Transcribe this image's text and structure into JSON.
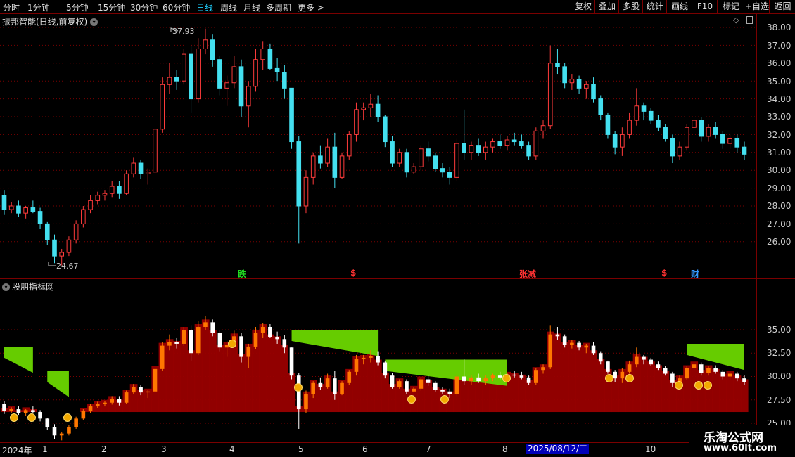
{
  "toolbar": {
    "periods": [
      "分时",
      "1分钟",
      "5分钟",
      "15分钟",
      "30分钟",
      "60分钟",
      "日线",
      "周线",
      "月线",
      "多周期",
      "更多 >"
    ],
    "active_period": "日线",
    "right_buttons": [
      "复权",
      "叠加",
      "多股",
      "统计",
      "画线",
      "F10",
      "+自选",
      "返回"
    ],
    "mark_label": "标记"
  },
  "main_chart": {
    "title": "振邦智能(日线,前复权)",
    "high_label": "37.93",
    "low_label": "24.67",
    "y_ticks": [
      "38.00",
      "37.00",
      "36.00",
      "35.00",
      "34.00",
      "33.00",
      "32.00",
      "31.00",
      "30.00",
      "29.00",
      "28.00",
      "27.00",
      "26.00"
    ],
    "signals": [
      {
        "text": "跌",
        "color": "#22dd22"
      },
      {
        "text": "$",
        "color": "#ff3333"
      },
      {
        "text": "张减",
        "color": "#ff3333"
      },
      {
        "text": "$",
        "color": "#ff3333"
      },
      {
        "text": "财",
        "color": "#3399ff"
      }
    ]
  },
  "indicator": {
    "title": "股朋指标网",
    "y_ticks": [
      "35.00",
      "32.50",
      "30.00",
      "27.50",
      "25.00"
    ]
  },
  "x_axis": {
    "labels": [
      "2024年",
      "1",
      "2",
      "3",
      "4",
      "5",
      "6",
      "7",
      "8",
      "9",
      "10"
    ],
    "cursor_date": "2025/08/12/二"
  },
  "watermark": {
    "line1": "乐淘公式网",
    "line2": "www.60lt.com"
  },
  "colors": {
    "up": "#ff3b3b",
    "down": "#44e0f0",
    "grid": "#7a0000",
    "green_fill": "#66cc00",
    "red_fill": "#990000",
    "orange": "#ff7700",
    "active_tab": "#1fd0ff"
  },
  "chart_data": {
    "type": "candlestick",
    "y_range": [
      25,
      38.5
    ],
    "indicator_y_range": [
      25,
      37.5
    ],
    "candles": [
      [
        28.6,
        28.9,
        27.5,
        27.8
      ],
      [
        27.8,
        28.2,
        27.6,
        28.0
      ],
      [
        28.0,
        28.3,
        27.4,
        27.6
      ],
      [
        27.6,
        28.0,
        27.3,
        27.9
      ],
      [
        27.9,
        28.3,
        27.6,
        27.7
      ],
      [
        27.7,
        27.9,
        26.7,
        27.0
      ],
      [
        27.0,
        27.1,
        25.8,
        26.1
      ],
      [
        26.1,
        26.4,
        24.8,
        25.2
      ],
      [
        25.2,
        25.6,
        24.67,
        25.4
      ],
      [
        25.4,
        26.3,
        25.2,
        26.1
      ],
      [
        26.1,
        27.2,
        25.9,
        27.0
      ],
      [
        27.0,
        28.0,
        26.8,
        27.8
      ],
      [
        27.8,
        28.6,
        27.6,
        28.3
      ],
      [
        28.3,
        28.8,
        28.1,
        28.6
      ],
      [
        28.6,
        28.9,
        28.3,
        28.7
      ],
      [
        28.7,
        29.4,
        28.5,
        29.1
      ],
      [
        29.1,
        29.4,
        28.4,
        28.7
      ],
      [
        28.7,
        30.0,
        28.6,
        29.8
      ],
      [
        29.8,
        30.7,
        29.6,
        30.4
      ],
      [
        30.4,
        30.6,
        29.5,
        29.8
      ],
      [
        29.8,
        30.1,
        29.2,
        29.9
      ],
      [
        29.9,
        32.6,
        29.8,
        32.3
      ],
      [
        32.3,
        35.2,
        32.1,
        34.8
      ],
      [
        34.8,
        36.0,
        34.3,
        35.2
      ],
      [
        35.2,
        35.6,
        34.5,
        35.0
      ],
      [
        35.0,
        36.8,
        34.8,
        36.5
      ],
      [
        36.5,
        37.0,
        33.2,
        34.0
      ],
      [
        34.0,
        37.4,
        33.8,
        36.8
      ],
      [
        36.8,
        37.93,
        36.5,
        37.3
      ],
      [
        37.3,
        37.6,
        35.8,
        36.2
      ],
      [
        36.2,
        36.4,
        34.2,
        34.6
      ],
      [
        34.6,
        35.3,
        33.6,
        34.9
      ],
      [
        34.9,
        36.4,
        34.6,
        35.8
      ],
      [
        35.8,
        36.2,
        33.0,
        33.6
      ],
      [
        33.6,
        35.0,
        32.4,
        34.7
      ],
      [
        34.7,
        36.8,
        34.4,
        36.2
      ],
      [
        36.2,
        37.2,
        35.6,
        36.8
      ],
      [
        36.8,
        37.1,
        35.6,
        35.7
      ],
      [
        35.7,
        36.3,
        35.0,
        35.5
      ],
      [
        35.5,
        35.9,
        34.0,
        34.6
      ],
      [
        34.6,
        34.6,
        31.2,
        31.6
      ],
      [
        31.6,
        31.9,
        25.9,
        28.0
      ],
      [
        28.0,
        30.0,
        27.6,
        29.6
      ],
      [
        29.6,
        31.0,
        29.2,
        30.8
      ],
      [
        30.8,
        31.4,
        30.1,
        30.4
      ],
      [
        30.4,
        31.8,
        30.2,
        31.3
      ],
      [
        31.3,
        32.1,
        29.0,
        29.6
      ],
      [
        29.6,
        31.0,
        29.5,
        30.8
      ],
      [
        30.8,
        32.2,
        30.6,
        32.0
      ],
      [
        32.0,
        33.8,
        31.6,
        33.4
      ],
      [
        33.4,
        33.8,
        32.8,
        33.5
      ],
      [
        33.5,
        34.3,
        33.0,
        33.7
      ],
      [
        33.7,
        34.2,
        32.7,
        33.0
      ],
      [
        33.0,
        33.1,
        31.3,
        31.6
      ],
      [
        31.6,
        31.9,
        30.2,
        30.4
      ],
      [
        30.4,
        31.2,
        30.2,
        31.0
      ],
      [
        31.0,
        31.2,
        29.6,
        29.9
      ],
      [
        29.9,
        30.4,
        29.8,
        30.2
      ],
      [
        30.2,
        31.4,
        30.0,
        31.2
      ],
      [
        31.2,
        31.6,
        30.5,
        30.8
      ],
      [
        30.8,
        31.0,
        29.9,
        30.1
      ],
      [
        30.1,
        30.4,
        29.6,
        29.9
      ],
      [
        29.9,
        30.2,
        29.2,
        29.6
      ],
      [
        29.6,
        31.8,
        29.4,
        31.5
      ],
      [
        31.5,
        33.4,
        30.6,
        31.0
      ],
      [
        31.0,
        31.6,
        30.6,
        31.4
      ],
      [
        31.4,
        31.8,
        30.8,
        31.0
      ],
      [
        31.0,
        31.6,
        30.6,
        31.3
      ],
      [
        31.3,
        31.8,
        31.0,
        31.6
      ],
      [
        31.6,
        32.0,
        31.2,
        31.4
      ],
      [
        31.4,
        31.9,
        31.1,
        31.7
      ],
      [
        31.7,
        32.1,
        31.4,
        31.6
      ],
      [
        31.6,
        32.0,
        31.2,
        31.4
      ],
      [
        31.4,
        31.6,
        30.6,
        30.8
      ],
      [
        30.8,
        32.4,
        30.6,
        32.2
      ],
      [
        32.2,
        32.8,
        31.8,
        32.5
      ],
      [
        32.5,
        37.0,
        32.3,
        36.0
      ],
      [
        36.0,
        36.8,
        35.4,
        35.8
      ],
      [
        35.8,
        36.0,
        34.6,
        34.9
      ],
      [
        34.9,
        35.4,
        34.5,
        35.1
      ],
      [
        35.1,
        35.3,
        34.3,
        34.6
      ],
      [
        34.6,
        35.0,
        34.0,
        34.8
      ],
      [
        34.8,
        35.2,
        33.8,
        34.0
      ],
      [
        34.0,
        34.2,
        32.8,
        33.1
      ],
      [
        33.1,
        33.2,
        31.8,
        32.0
      ],
      [
        32.0,
        32.2,
        30.9,
        31.3
      ],
      [
        31.3,
        32.4,
        30.8,
        32.0
      ],
      [
        32.0,
        33.2,
        31.8,
        32.8
      ],
      [
        32.8,
        34.6,
        32.5,
        33.6
      ],
      [
        33.6,
        33.8,
        32.8,
        33.3
      ],
      [
        33.3,
        33.5,
        32.6,
        32.8
      ],
      [
        32.8,
        33.1,
        32.2,
        32.4
      ],
      [
        32.4,
        32.6,
        31.6,
        31.8
      ],
      [
        31.8,
        32.0,
        30.4,
        30.8
      ],
      [
        30.8,
        31.6,
        30.6,
        31.3
      ],
      [
        31.3,
        32.6,
        31.1,
        32.4
      ],
      [
        32.4,
        33.0,
        32.2,
        32.8
      ],
      [
        32.8,
        33.0,
        31.6,
        31.9
      ],
      [
        31.9,
        32.6,
        31.6,
        32.4
      ],
      [
        32.4,
        32.7,
        31.8,
        32.0
      ],
      [
        32.0,
        32.2,
        31.2,
        31.5
      ],
      [
        31.5,
        32.0,
        31.2,
        31.8
      ],
      [
        31.8,
        32.0,
        31.0,
        31.3
      ],
      [
        31.3,
        31.6,
        30.6,
        30.9
      ]
    ]
  }
}
